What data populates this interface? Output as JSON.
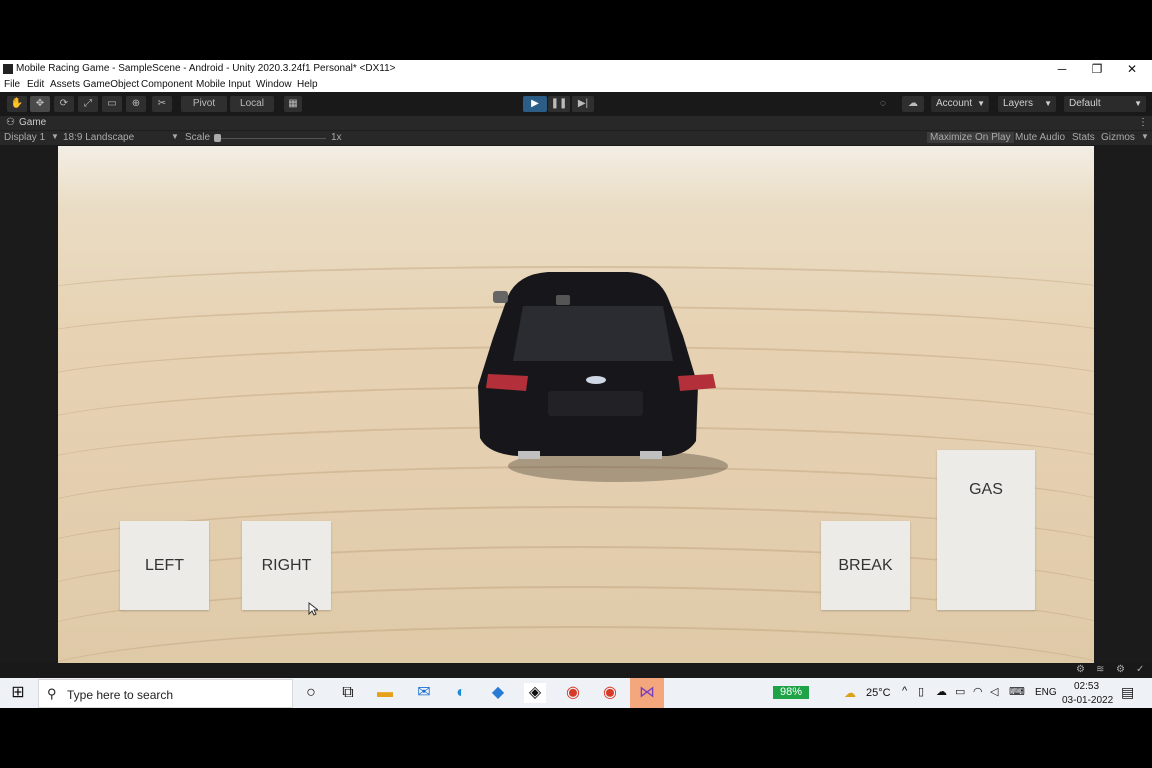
{
  "window": {
    "title": "Mobile Racing Game - SampleScene - Android - Unity 2020.3.24f1 Personal* <DX11>",
    "minimize": "─",
    "restore": "❐",
    "close": "✕"
  },
  "menu": [
    "File",
    "Edit",
    "Assets",
    "GameObject",
    "Component",
    "Mobile Input",
    "Window",
    "Help"
  ],
  "toolbar": {
    "pivot": "Pivot",
    "local": "Local",
    "account": "Account",
    "layers": "Layers",
    "layout": "Default"
  },
  "game_tab": {
    "label": "Game"
  },
  "game_bar": {
    "display": "Display 1",
    "aspect": "18:9 Landscape",
    "scale_label": "Scale",
    "scale_value": "1x",
    "maximize": "Maximize On Play",
    "mute": "Mute Audio",
    "stats": "Stats",
    "gizmos": "Gizmos"
  },
  "controls": {
    "left": "LEFT",
    "right": "RIGHT",
    "brake": "BREAK",
    "gas": "GAS"
  },
  "taskbar": {
    "search_placeholder": "Type here to search",
    "battery": "98%",
    "weather": "25°C",
    "language": "ENG",
    "time": "02:53",
    "date": "03-01-2022"
  }
}
